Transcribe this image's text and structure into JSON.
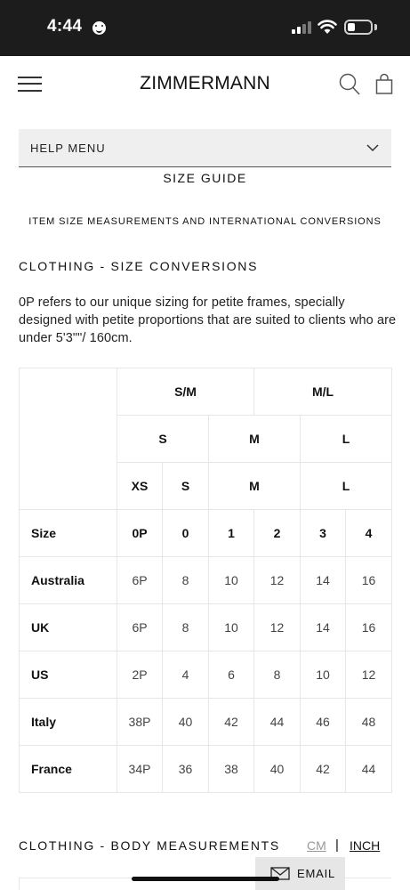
{
  "status_bar": {
    "time": "4:44",
    "icons": [
      "face-emoji-icon",
      "signal-icon",
      "wifi-icon",
      "battery-icon"
    ]
  },
  "header": {
    "logo": "ZIMMERMANN",
    "icons": [
      "hamburger-menu-icon",
      "search-icon",
      "shopping-bag-icon"
    ]
  },
  "help_menu": {
    "label": "HELP MENU"
  },
  "page": {
    "title": "SIZE GUIDE",
    "subtitle": "ITEM SIZE MEASUREMENTS AND INTERNATIONAL CONVERSIONS",
    "section_heading": "CLOTHING - SIZE CONVERSIONS",
    "description": "0P refers to our unique sizing for petite frames, specially designed with petite proportions that are suited to clients who are under 5'3\"\"/ 160cm."
  },
  "size_table": {
    "group_row": [
      "S/M",
      "M/L"
    ],
    "letter_row": [
      "S",
      "M",
      "L"
    ],
    "detail_row": [
      "XS",
      "S",
      "M",
      "L"
    ],
    "rows": [
      {
        "label": "Size",
        "values": [
          "0P",
          "0",
          "1",
          "2",
          "3",
          "4"
        ]
      },
      {
        "label": "Australia",
        "values": [
          "6P",
          "8",
          "10",
          "12",
          "14",
          "16"
        ]
      },
      {
        "label": "UK",
        "values": [
          "6P",
          "8",
          "10",
          "12",
          "14",
          "16"
        ]
      },
      {
        "label": "US",
        "values": [
          "2P",
          "4",
          "6",
          "8",
          "10",
          "12"
        ]
      },
      {
        "label": "Italy",
        "values": [
          "38P",
          "40",
          "42",
          "44",
          "46",
          "48"
        ]
      },
      {
        "label": "France",
        "values": [
          "34P",
          "36",
          "38",
          "40",
          "42",
          "44"
        ]
      }
    ]
  },
  "body_measurements": {
    "heading": "CLOTHING - BODY MEASUREMENTS",
    "unit_cm": "CM",
    "separator": "|",
    "unit_inch": "INCH"
  },
  "email_button": {
    "label": "EMAIL"
  }
}
